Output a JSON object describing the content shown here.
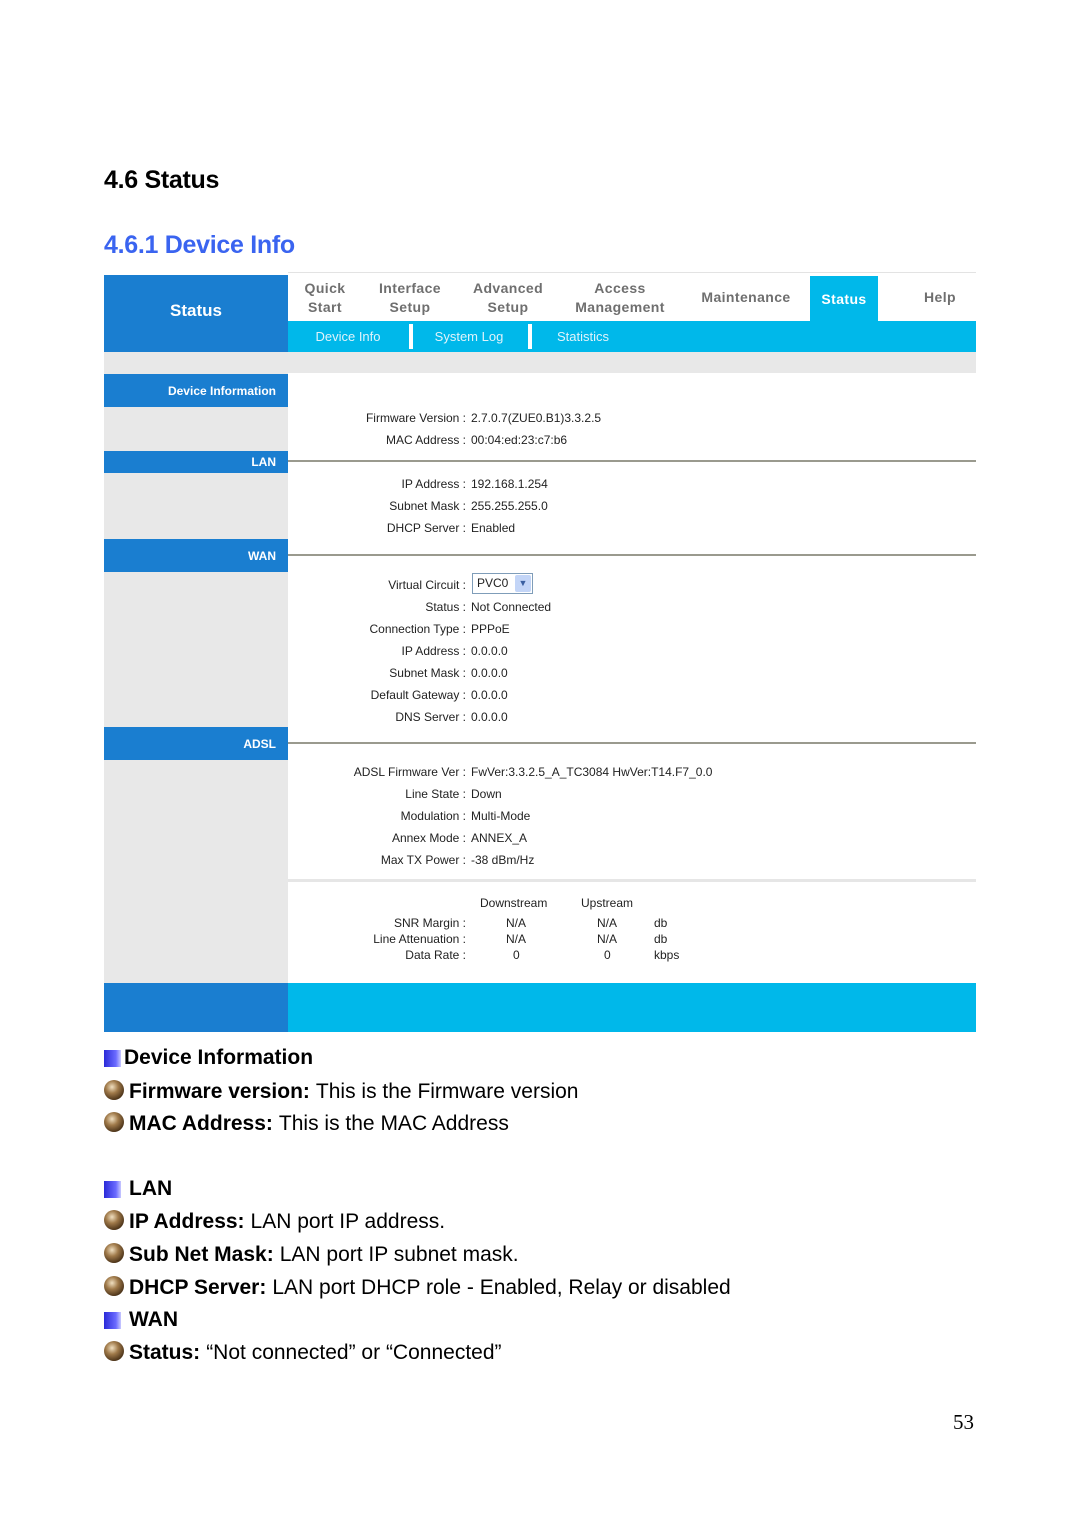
{
  "headings": {
    "section": "4.6 Status",
    "subsection": "4.6.1 Device Info"
  },
  "router_ui": {
    "brand": "Status",
    "top_menu": [
      {
        "label": "Quick\nStart",
        "active": false
      },
      {
        "label": "Interface\nSetup",
        "active": false
      },
      {
        "label": "Advanced\nSetup",
        "active": false
      },
      {
        "label": "Access\nManagement",
        "active": false
      },
      {
        "label": "Maintenance",
        "active": false
      },
      {
        "label": "Status",
        "active": true
      },
      {
        "label": "Help",
        "active": false
      }
    ],
    "sub_menu": [
      "Device Info",
      "System Log",
      "Statistics"
    ],
    "sections": {
      "device_info": {
        "title": "Device Information",
        "fields": [
          {
            "label": "Firmware Version :",
            "value": "2.7.0.7(ZUE0.B1)3.3.2.5"
          },
          {
            "label": "MAC Address :",
            "value": "00:04:ed:23:c7:b6"
          }
        ]
      },
      "lan": {
        "title": "LAN",
        "fields": [
          {
            "label": "IP Address :",
            "value": "192.168.1.254"
          },
          {
            "label": "Subnet Mask :",
            "value": "255.255.255.0"
          },
          {
            "label": "DHCP Server :",
            "value": "Enabled"
          }
        ]
      },
      "wan": {
        "title": "WAN",
        "virtual_circuit": {
          "label": "Virtual Circuit :",
          "selected": "PVC0"
        },
        "fields": [
          {
            "label": "Status :",
            "value": "Not Connected"
          },
          {
            "label": "Connection Type :",
            "value": "PPPoE"
          },
          {
            "label": "IP Address :",
            "value": "0.0.0.0"
          },
          {
            "label": "Subnet Mask :",
            "value": "0.0.0.0"
          },
          {
            "label": "Default Gateway :",
            "value": "0.0.0.0"
          },
          {
            "label": "DNS Server :",
            "value": "0.0.0.0"
          }
        ]
      },
      "adsl": {
        "title": "ADSL",
        "fields": [
          {
            "label": "ADSL Firmware Ver :",
            "value": "FwVer:3.3.2.5_A_TC3084 HwVer:T14.F7_0.0"
          },
          {
            "label": "Line State :",
            "value": "Down"
          },
          {
            "label": "Modulation :",
            "value": "Multi-Mode"
          },
          {
            "label": "Annex Mode :",
            "value": "ANNEX_A"
          },
          {
            "label": "Max TX Power :",
            "value": "-38 dBm/Hz"
          }
        ],
        "stats": {
          "headers": [
            "Downstream",
            "Upstream"
          ],
          "rows": [
            {
              "label": "SNR Margin :",
              "downstream": "N/A",
              "upstream": "N/A",
              "unit": "db"
            },
            {
              "label": "Line Attenuation :",
              "downstream": "N/A",
              "upstream": "N/A",
              "unit": "db"
            },
            {
              "label": "Data Rate :",
              "downstream": "0",
              "upstream": "0",
              "unit": "kbps"
            }
          ]
        }
      }
    }
  },
  "doc": {
    "device_info": {
      "title": "Device Information",
      "items": [
        {
          "term": "Firmware version:",
          "desc": "This is the Firmware version"
        },
        {
          "term": "MAC Address:",
          "desc": "This is the MAC Address"
        }
      ]
    },
    "lan": {
      "title": "LAN",
      "items": [
        {
          "term": "IP Address:",
          "desc": "LAN port IP address."
        },
        {
          "term": "Sub Net Mask:",
          "desc": "LAN port IP subnet mask."
        },
        {
          "term": "DHCP Server:",
          "desc": "LAN port DHCP role - Enabled, Relay or disabled"
        }
      ]
    },
    "wan": {
      "title": "WAN",
      "items": [
        {
          "term": "Status:",
          "desc": "“Not connected” or “Connected”"
        }
      ]
    }
  },
  "page_number": "53",
  "colors": {
    "brand_blue": "#1a7ed0",
    "accent_cyan": "#00b8ea",
    "heading_blue": "#3a64f0"
  }
}
